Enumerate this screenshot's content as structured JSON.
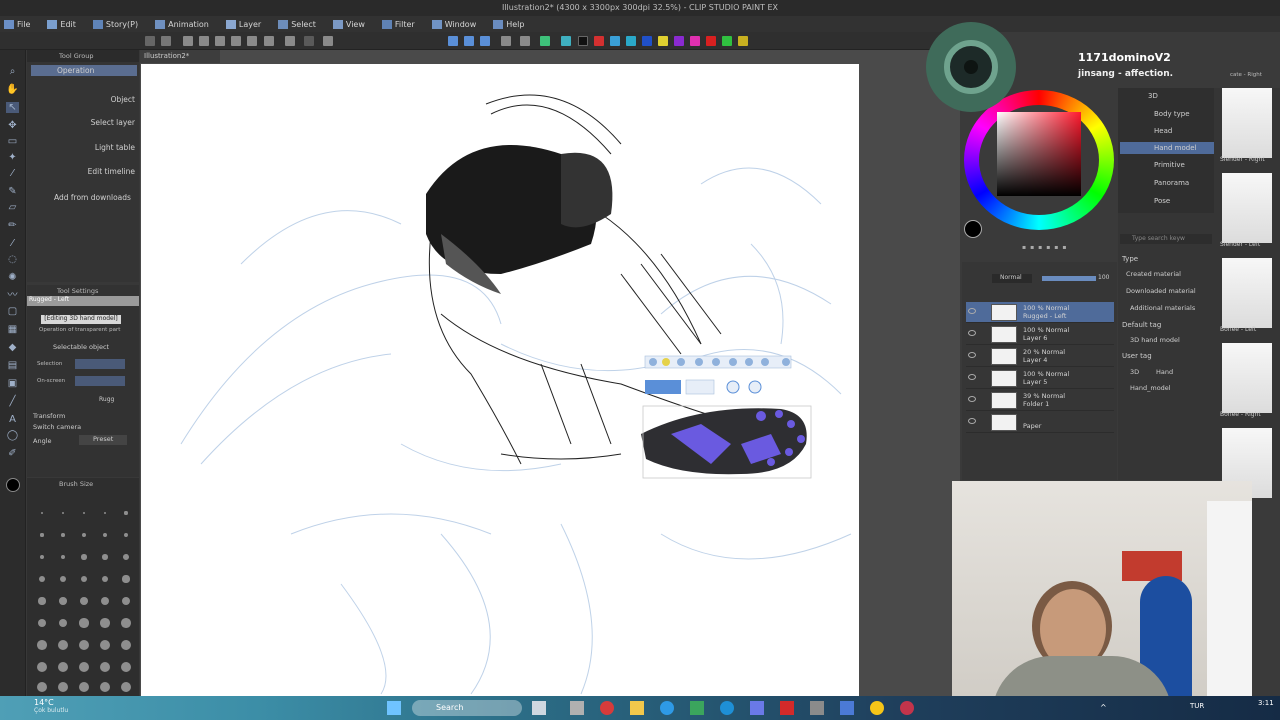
{
  "window": {
    "title": "Illustration2* (4300 x 3300px 300dpi 32.5%) - CLIP STUDIO PAINT EX"
  },
  "menu": [
    "File",
    "Edit",
    "Story(P)",
    "Animation",
    "Layer",
    "Select",
    "View",
    "Filter",
    "Window",
    "Help"
  ],
  "document_tab": "Illustration2*",
  "subtool_panel": {
    "header": "Tool Group",
    "active_group": "Operation",
    "items": [
      "Object",
      "Select layer",
      "Light table",
      "Edit timeline"
    ],
    "add_from_downloads": "Add from downloads"
  },
  "tool_settings": {
    "header": "Tool Settings",
    "selected_name": "Rugged - Left",
    "editing_label": "[Editing 3D hand model]",
    "operation_label": "Operation of transparent part",
    "selectable_object": "Selectable object",
    "selection_label": "Selection",
    "onscreen_label": "On-screen",
    "rugged_value": "Rugg",
    "transform_label": "Transform",
    "switch_camera_label": "Switch camera",
    "angle_label": "Angle",
    "preset_label": "Preset"
  },
  "brush_size": {
    "header": "Brush Size"
  },
  "stream": {
    "username": "1171dominoV2",
    "message": "jinsang - affection."
  },
  "layers": {
    "blend_mode": "Normal",
    "opacity": "100",
    "items": [
      {
        "line1": "100 % Normal",
        "line2": "Rugged - Left",
        "selected": true
      },
      {
        "line1": "100 % Normal",
        "line2": "Layer 6",
        "selected": false
      },
      {
        "line1": "20 % Normal",
        "line2": "Layer 4",
        "selected": false
      },
      {
        "line1": "100 % Normal",
        "line2": "Layer 5",
        "selected": false
      },
      {
        "line1": "39 % Normal",
        "line2": "Folder 1",
        "selected": false
      },
      {
        "line1": "",
        "line2": "Paper",
        "selected": false
      }
    ]
  },
  "materials": {
    "tree": [
      "3D",
      "Body type",
      "Head",
      "Hand model",
      "Primitive",
      "Panorama",
      "Pose"
    ],
    "selected_tree_item": "Hand model",
    "search_placeholder": "Type search keyw",
    "type_header": "Type",
    "types": [
      "Created material",
      "Downloaded material",
      "Additional materials"
    ],
    "default_tag_header": "Default tag",
    "default_tag": "3D hand model",
    "user_tag_header": "User tag",
    "user_tags": [
      "3D",
      "Hand",
      "Hand_model"
    ],
    "thumb_labels": [
      "Slender - Right",
      "Slender - Left",
      "Bonee - Left",
      "Bonee - Right"
    ],
    "header_crop": "cate - Right"
  },
  "taskbar": {
    "temperature": "14°C",
    "weather": "Çok bulutlu",
    "search": "Search",
    "lang": "TUR",
    "time": "3:11"
  },
  "colors": {
    "accent": "#5a8fd8",
    "hand": "#2e2e32",
    "hand_highlight": "#6a5ae0",
    "selected_layer": "#4f6b9a"
  }
}
